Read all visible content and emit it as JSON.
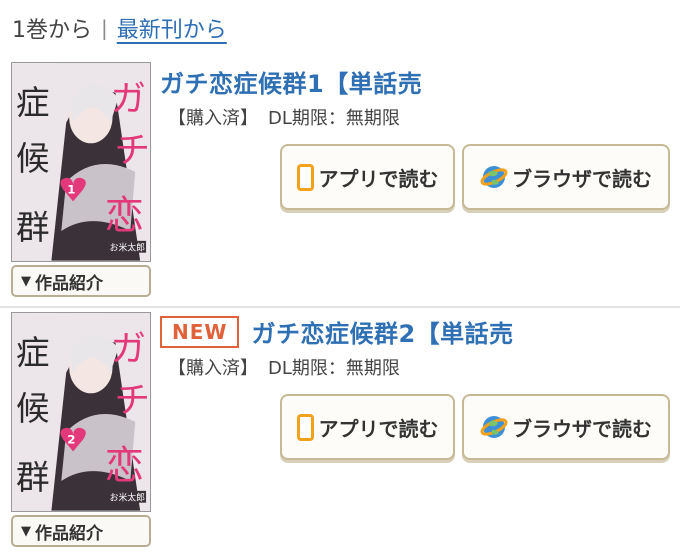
{
  "sort": {
    "current": "1巻から",
    "separator": "|",
    "link": "最新刊から"
  },
  "entries": [
    {
      "badge": "",
      "title": "ガチ恋症候群1【単話売",
      "purchase_status": "【購入済】",
      "expiry": "DL期限：無期限",
      "app_button": "アプリで読む",
      "browser_button": "ブラウザで読む",
      "intro_button": "作品紹介",
      "intro_marker": "▼",
      "volume_number": "1",
      "author": "お米太郎"
    },
    {
      "badge": "NEW",
      "title": "ガチ恋症候群2【単話売",
      "purchase_status": "【購入済】",
      "expiry": "DL期限：無期限",
      "app_button": "アプリで読む",
      "browser_button": "ブラウザで読む",
      "intro_button": "作品紹介",
      "intro_marker": "▼",
      "volume_number": "2",
      "author": "お米太郎"
    }
  ],
  "colors": {
    "link": "#2f6fb3",
    "new_badge": "#e0613a",
    "phone_icon": "#f2a11a",
    "button_border": "#c7b996",
    "cover_pink": "#e3397a"
  },
  "icons": {
    "app": "smartphone-icon",
    "browser": "globe-icon"
  }
}
